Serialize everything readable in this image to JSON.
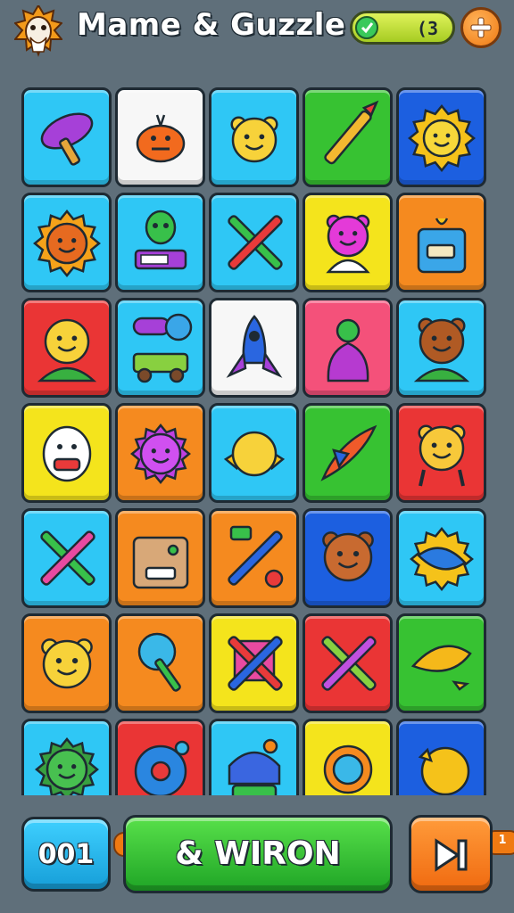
{
  "header": {
    "title": "Mame & Guzzle",
    "currency_value": "(3",
    "gem_icon": "gem-icon",
    "add_icon": "plus-icon",
    "avatar_icon": "sun-face-avatar"
  },
  "colors": {
    "background": "#5f6f7a",
    "cyan": "#2fc7f5",
    "white": "#f7f7f7",
    "green": "#37c232",
    "blue": "#1c5fe0",
    "orange": "#f58a1f",
    "yellow": "#f4e41c",
    "red": "#ea3535",
    "pink": "#f4517a"
  },
  "board": {
    "rows": [
      [
        {
          "color": "cyan",
          "icon": "purple-ufo-icon"
        },
        {
          "color": "white",
          "icon": "orange-crab-icon"
        },
        {
          "color": "cyan",
          "icon": "yellow-cat-face-icon"
        },
        {
          "color": "green",
          "icon": "rocket-pencil-icon"
        },
        {
          "color": "blue",
          "icon": "sun-face-icon"
        }
      ],
      [
        {
          "color": "cyan",
          "icon": "orange-sunflower-face-icon"
        },
        {
          "color": "cyan",
          "icon": "green-robot-icon"
        },
        {
          "color": "cyan",
          "icon": "crossed-swords-icon"
        },
        {
          "color": "yellow",
          "icon": "pink-bear-icon"
        },
        {
          "color": "orange",
          "icon": "gift-box-icon"
        }
      ],
      [
        {
          "color": "red",
          "icon": "yellow-kid-face-icon"
        },
        {
          "color": "cyan",
          "icon": "purple-truck-icon"
        },
        {
          "color": "white",
          "icon": "blue-rocket-icon"
        },
        {
          "color": "pink",
          "icon": "purple-onion-icon"
        },
        {
          "color": "cyan",
          "icon": "brown-bear-kid-icon"
        }
      ],
      [
        {
          "color": "yellow",
          "icon": "white-egg-face-icon"
        },
        {
          "color": "orange",
          "icon": "purple-blob-icon"
        },
        {
          "color": "cyan",
          "icon": "yellow-ball-icon"
        },
        {
          "color": "green",
          "icon": "red-jet-icon"
        },
        {
          "color": "red",
          "icon": "yellow-bear-icon"
        }
      ],
      [
        {
          "color": "cyan",
          "icon": "crossed-bats-icon"
        },
        {
          "color": "orange",
          "icon": "brown-radio-icon"
        },
        {
          "color": "orange",
          "icon": "tools-icon"
        },
        {
          "color": "blue",
          "icon": "brown-bear-face-icon"
        },
        {
          "color": "cyan",
          "icon": "blue-star-splash-icon"
        }
      ],
      [
        {
          "color": "orange",
          "icon": "yellow-bear-face-icon"
        },
        {
          "color": "orange",
          "icon": "blue-lollipop-icon"
        },
        {
          "color": "yellow",
          "icon": "crossed-sticks-icon"
        },
        {
          "color": "red",
          "icon": "green-crossed-bones-icon"
        },
        {
          "color": "green",
          "icon": "yellow-boat-icon"
        }
      ],
      [
        {
          "color": "cyan",
          "icon": "green-lion-icon"
        },
        {
          "color": "red",
          "icon": "blue-donut-icon"
        },
        {
          "color": "cyan",
          "icon": "blue-robot-icon"
        },
        {
          "color": "yellow",
          "icon": "orange-astronaut-icon"
        },
        {
          "color": "blue",
          "icon": "yellow-shell-icon"
        }
      ]
    ]
  },
  "footer": {
    "count_label": "001",
    "count_badge": "",
    "main_label": "& WIRON",
    "main_badge": "1",
    "next_icon": "skip-next-icon"
  }
}
